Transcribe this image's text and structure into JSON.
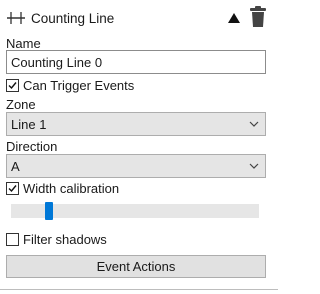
{
  "header": {
    "title": "Counting Line",
    "line_icon": "line-tool-icon",
    "collapse_icon": "triangle-up-icon",
    "delete_icon": "trash-icon"
  },
  "name": {
    "label": "Name",
    "value": "Counting Line 0"
  },
  "can_trigger_events": {
    "label": "Can Trigger Events",
    "checked": true
  },
  "zone": {
    "label": "Zone",
    "selected": "Line 1"
  },
  "direction": {
    "label": "Direction",
    "selected": "A"
  },
  "width_calibration": {
    "label": "Width calibration",
    "checked": true,
    "slider_value": 0.14
  },
  "filter_shadows": {
    "label": "Filter shadows",
    "checked": false
  },
  "event_actions": {
    "label": "Event Actions"
  },
  "colors": {
    "accent": "#0078d7",
    "control_bg": "#e5e5e5",
    "button_bg": "#e1e1e1"
  }
}
